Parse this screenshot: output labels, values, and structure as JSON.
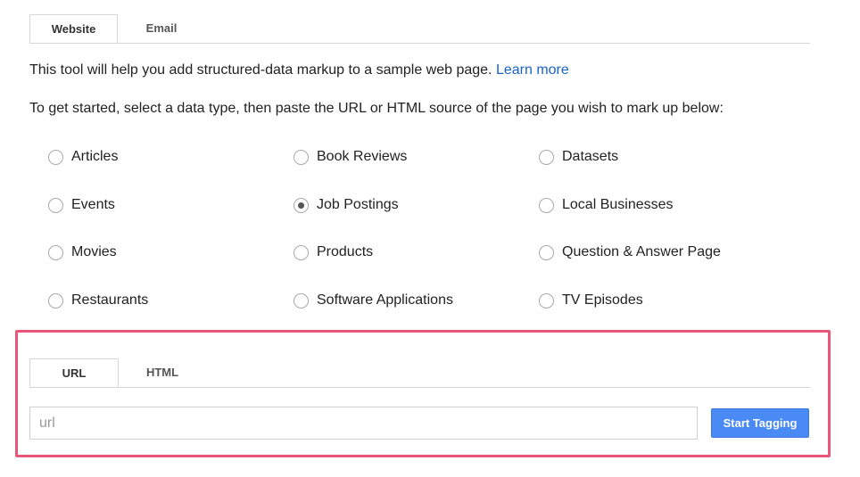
{
  "top_tabs": {
    "website_label": "Website",
    "email_label": "Email",
    "active": "Website"
  },
  "intro": {
    "text": "This tool will help you add structured-data markup to a sample web page.",
    "learn_more": "Learn more"
  },
  "instructions": "To get started, select a data type, then paste the URL or HTML source of the page you wish to mark up below:",
  "data_types": [
    {
      "label": "Articles",
      "checked": false
    },
    {
      "label": "Book Reviews",
      "checked": false
    },
    {
      "label": "Datasets",
      "checked": false
    },
    {
      "label": "Events",
      "checked": false
    },
    {
      "label": "Job Postings",
      "checked": true
    },
    {
      "label": "Local Businesses",
      "checked": false
    },
    {
      "label": "Movies",
      "checked": false
    },
    {
      "label": "Products",
      "checked": false
    },
    {
      "label": "Question & Answer Page",
      "checked": false
    },
    {
      "label": "Restaurants",
      "checked": false
    },
    {
      "label": "Software Applications",
      "checked": false
    },
    {
      "label": "TV Episodes",
      "checked": false
    }
  ],
  "source_tabs": {
    "url_label": "URL",
    "html_label": "HTML",
    "active": "URL"
  },
  "url_input": {
    "value": "",
    "placeholder": "url"
  },
  "start_button_label": "Start Tagging",
  "colors": {
    "accent": "#4a8af4",
    "highlight_border": "#e8577a",
    "link": "#1a63c6"
  }
}
